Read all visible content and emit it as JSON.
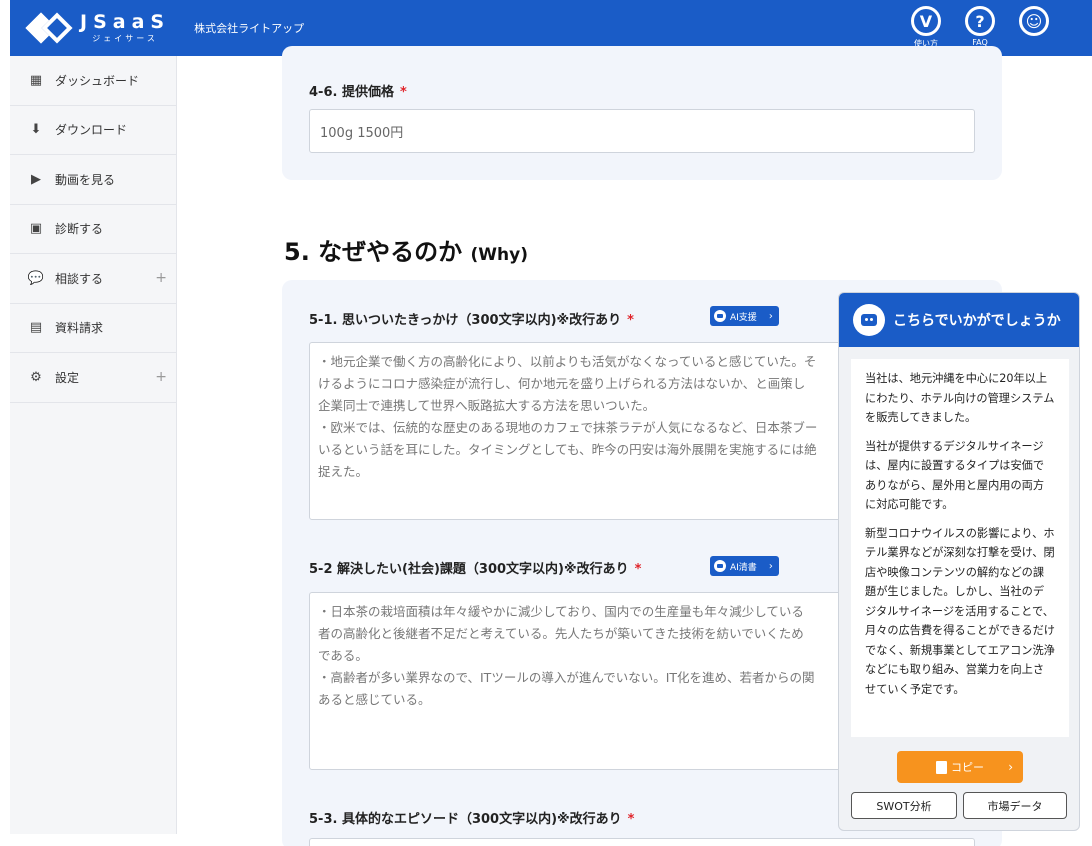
{
  "header": {
    "logo_main": "JSaaS",
    "logo_sub": "ジェイサース",
    "company": "株式会社ライトアップ",
    "icons": [
      {
        "name": "how-to-icon",
        "glyph": "V",
        "label": "使い方"
      },
      {
        "name": "faq-icon",
        "glyph": "?",
        "label": "FAQ"
      },
      {
        "name": "account-icon",
        "glyph": "☺",
        "label": ""
      }
    ]
  },
  "sidebar": {
    "items": [
      {
        "label": "ダッシュボード",
        "icon": "dashboard-icon",
        "glyph": "▦",
        "expand": ""
      },
      {
        "label": "ダウンロード",
        "icon": "download-icon",
        "glyph": "⬇",
        "expand": ""
      },
      {
        "label": "動画を見る",
        "icon": "video-icon",
        "glyph": "▶",
        "expand": ""
      },
      {
        "label": "診断する",
        "icon": "diagnose-icon",
        "glyph": "▣",
        "expand": ""
      },
      {
        "label": "相談する",
        "icon": "chat-icon",
        "glyph": "💬",
        "expand": "+"
      },
      {
        "label": "資料請求",
        "icon": "document-icon",
        "glyph": "▤",
        "expand": ""
      },
      {
        "label": "設定",
        "icon": "gear-icon",
        "glyph": "⚙",
        "expand": "+"
      }
    ]
  },
  "main": {
    "price": {
      "label": "4-6. 提供価格",
      "required": "*",
      "value": "100g 1500円"
    },
    "section5": {
      "title": "5. なぜやるのか",
      "subtitle": "(Why)"
    },
    "q51": {
      "label": "5-1. 思いついたきっかけ（300文字以内)※改行あり",
      "required": "*",
      "ai_button": "AI支援",
      "text": "・地元企業で働く方の高齢化により、以前よりも活気がなくなっていると感じていた。そ\nけるようにコロナ感染症が流行し、何か地元を盛り上げられる方法はないか、と画策し\n企業同士で連携して世界へ販路拡大する方法を思いついた。\n・欧米では、伝統的な歴史のある現地のカフェで抹茶ラテが人気になるなど、日本茶ブー\nいるという話を耳にした。タイミングとしても、昨今の円安は海外展開を実施するには絶\n捉えた。"
    },
    "q52": {
      "label": "5-2 解決したい(社会)課題（300文字以内)※改行あり",
      "required": "*",
      "ai_button": "AI清書",
      "text": "・日本茶の栽培面積は年々緩やかに減少しており、国内での生産量も年々減少している\n者の高齢化と後継者不足だと考えている。先人たちが築いてきた技術を紡いでいくため\nである。\n・高齢者が多い業界なので、ITツールの導入が進んでいない。IT化を進め、若者からの関\nあると感じている。"
    },
    "q53": {
      "label": "5-3. 具体的なエピソード（300文字以内)※改行あり",
      "required": "*"
    }
  },
  "popup": {
    "title": "こちらでいかがでしょうか",
    "paragraphs": [
      "当社は、地元沖縄を中心に20年以上にわたり、ホテル向けの管理システムを販売してきました。",
      "当社が提供するデジタルサイネージは、屋内に設置するタイプは安価でありながら、屋外用と屋内用の両方に対応可能です。",
      "新型コロナウイルスの影響により、ホテル業界などが深刻な打撃を受け、閉店や映像コンテンツの解約などの課題が生じました。しかし、当社のデジタルサイネージを活用することで、月々の広告費を得ることができるだけでなく、新規事業としてエアコン洗浄などにも取り組み、営業力を向上させていく予定です。"
    ],
    "copy_button": "コピー",
    "swot_button": "SWOT分析",
    "market_button": "市場データ"
  },
  "colors": {
    "header_blue": "#1a5cc7",
    "required_red": "#e0242a",
    "copy_orange": "#f7931e"
  }
}
